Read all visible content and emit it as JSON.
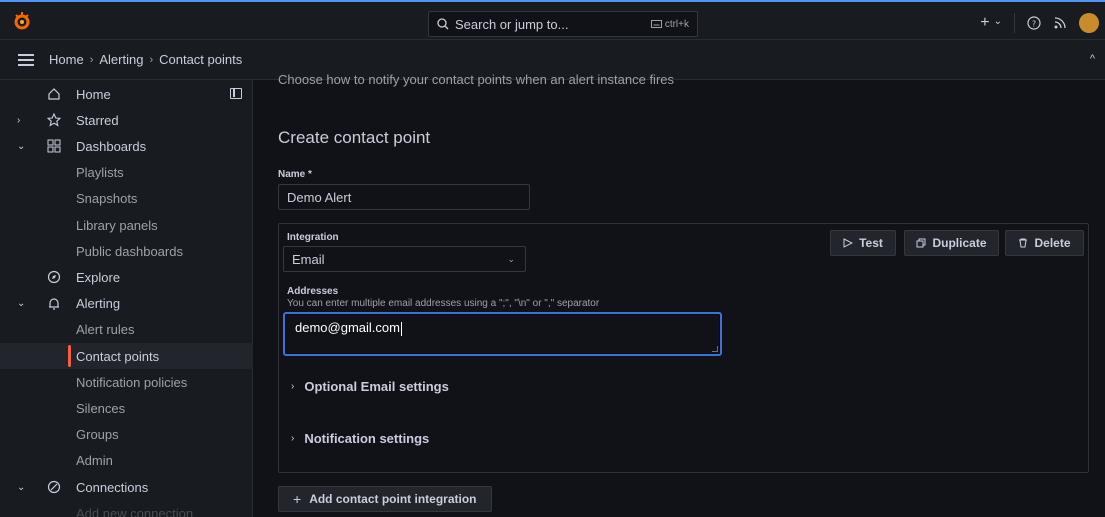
{
  "topbar": {
    "search_placeholder": "Search or jump to...",
    "search_shortcut": "ctrl+k",
    "new_label": "+",
    "new_chevron": "⌄"
  },
  "breadcrumb": [
    "Home",
    "Alerting",
    "Contact points"
  ],
  "sidebar": {
    "items": [
      {
        "label": "Home",
        "expand": "",
        "icon": "home-icon",
        "type": "top"
      },
      {
        "label": "Starred",
        "expand": "›",
        "icon": "star-icon",
        "type": "top"
      },
      {
        "label": "Dashboards",
        "expand": "⌄",
        "icon": "grid-icon",
        "type": "top"
      },
      {
        "label": "Playlists",
        "type": "sub"
      },
      {
        "label": "Snapshots",
        "type": "sub"
      },
      {
        "label": "Library panels",
        "type": "sub"
      },
      {
        "label": "Public dashboards",
        "type": "sub"
      },
      {
        "label": "Explore",
        "expand": "",
        "icon": "compass-icon",
        "type": "top"
      },
      {
        "label": "Alerting",
        "expand": "⌄",
        "icon": "bell-icon",
        "type": "top"
      },
      {
        "label": "Alert rules",
        "type": "sub"
      },
      {
        "label": "Contact points",
        "type": "sub",
        "active": true
      },
      {
        "label": "Notification policies",
        "type": "sub"
      },
      {
        "label": "Silences",
        "type": "sub"
      },
      {
        "label": "Groups",
        "type": "sub"
      },
      {
        "label": "Admin",
        "type": "sub"
      },
      {
        "label": "Connections",
        "expand": "⌄",
        "icon": "connections-icon",
        "type": "top"
      },
      {
        "label": "Add new connection",
        "type": "sub",
        "dim": true
      }
    ]
  },
  "main": {
    "subtitle": "Choose how to notify your contact points when an alert instance fires",
    "heading": "Create contact point",
    "name_label": "Name *",
    "name_value": "Demo Alert",
    "integration_label": "Integration",
    "integration_value": "Email",
    "test_button": "Test",
    "duplicate_button": "Duplicate",
    "delete_button": "Delete",
    "addresses_label": "Addresses",
    "addresses_desc": "You can enter multiple email addresses using a \";\", \"\\n\" or \",\" separator",
    "addresses_value": "demo@gmail.com",
    "optional_email_settings": "Optional Email settings",
    "notification_settings": "Notification settings",
    "add_integration_button": "Add contact point integration"
  },
  "colors": {
    "accent_blue": "#3d71d9",
    "active_orange": "#f55f3e",
    "background": "#111217",
    "panel": "#181b1f"
  }
}
